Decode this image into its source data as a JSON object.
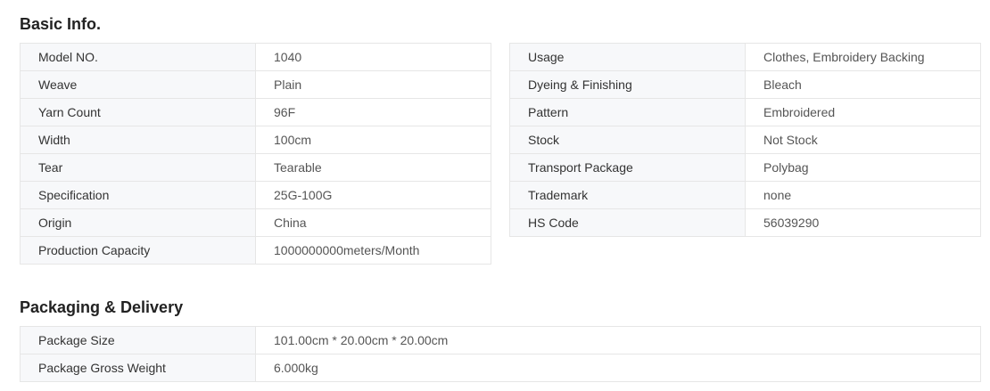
{
  "basic_info": {
    "title": "Basic Info.",
    "left": [
      {
        "key": "Model NO.",
        "value": "1040"
      },
      {
        "key": "Weave",
        "value": "Plain"
      },
      {
        "key": "Yarn Count",
        "value": "96F"
      },
      {
        "key": "Width",
        "value": "100cm"
      },
      {
        "key": "Tear",
        "value": "Tearable"
      },
      {
        "key": "Specification",
        "value": "25G-100G"
      },
      {
        "key": "Origin",
        "value": "China"
      },
      {
        "key": "Production Capacity",
        "value": "1000000000meters/Month"
      }
    ],
    "right": [
      {
        "key": "Usage",
        "value": "Clothes, Embroidery Backing"
      },
      {
        "key": "Dyeing & Finishing",
        "value": "Bleach"
      },
      {
        "key": "Pattern",
        "value": "Embroidered"
      },
      {
        "key": "Stock",
        "value": "Not Stock"
      },
      {
        "key": "Transport Package",
        "value": "Polybag"
      },
      {
        "key": "Trademark",
        "value": "none"
      },
      {
        "key": "HS Code",
        "value": "56039290"
      }
    ]
  },
  "packaging": {
    "title": "Packaging & Delivery",
    "rows": [
      {
        "key": "Package Size",
        "value": "101.00cm * 20.00cm * 20.00cm"
      },
      {
        "key": "Package Gross Weight",
        "value": "6.000kg"
      }
    ]
  }
}
